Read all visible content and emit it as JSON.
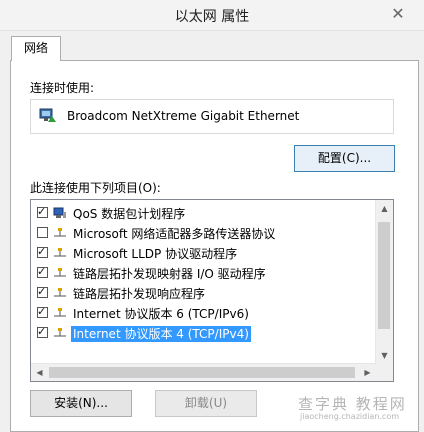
{
  "window": {
    "title": "以太网 属性",
    "close_glyph": "✕"
  },
  "tabs": [
    {
      "label": "网络"
    }
  ],
  "connect_using": {
    "label": "连接时使用:",
    "adapter": "Broadcom NetXtreme Gigabit Ethernet",
    "adapter_icon": "network-adapter-icon"
  },
  "buttons": {
    "configure": "配置(C)...",
    "install": "安装(N)...",
    "uninstall": "卸载(U)"
  },
  "items_label": "此连接使用下列项目(O):",
  "items": [
    {
      "label": "QoS 数据包计划程序",
      "checked": true,
      "icon": "qos-icon"
    },
    {
      "label": "Microsoft 网络适配器多路传送器协议",
      "checked": false,
      "icon": "protocol-icon"
    },
    {
      "label": "Microsoft LLDP 协议驱动程序",
      "checked": true,
      "icon": "protocol-icon"
    },
    {
      "label": "链路层拓扑发现映射器 I/O 驱动程序",
      "checked": true,
      "icon": "protocol-icon"
    },
    {
      "label": "链路层拓扑发现响应程序",
      "checked": true,
      "icon": "protocol-icon"
    },
    {
      "label": "Internet 协议版本 6 (TCP/IPv6)",
      "checked": true,
      "icon": "protocol-icon"
    },
    {
      "label": "Internet 协议版本 4 (TCP/IPv4)",
      "checked": true,
      "icon": "protocol-icon",
      "selected": true
    }
  ],
  "check_glyph": "✓",
  "scroll_glyphs": {
    "up": "▲",
    "down": "▼",
    "left": "◀",
    "right": "▶"
  },
  "watermark": {
    "main": "查字典 教程网",
    "sub": "jiaocheng.chazidian.com"
  },
  "colors": {
    "selection": "#3399ff",
    "focus_border": "#3c7fb1"
  }
}
